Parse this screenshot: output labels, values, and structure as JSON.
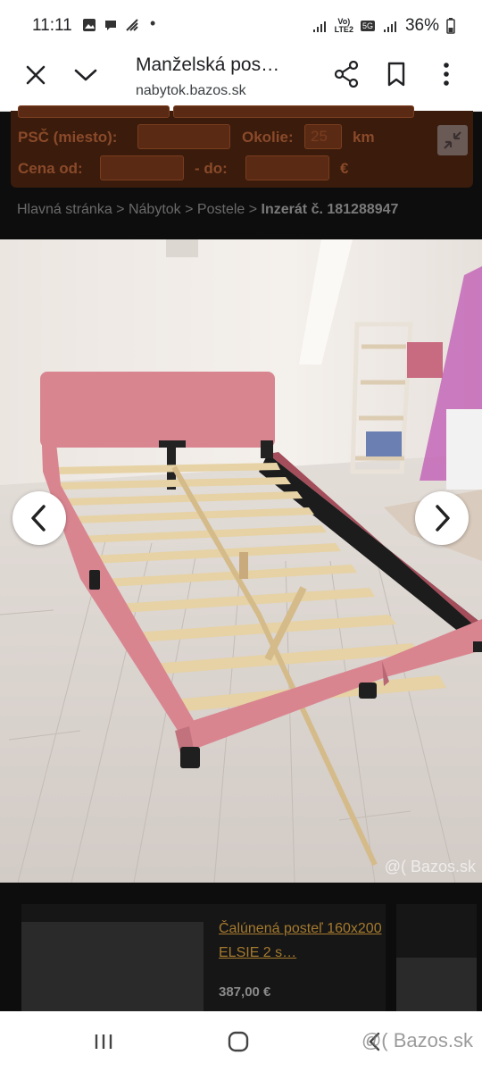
{
  "status_bar": {
    "time": "11:11",
    "network": "LTE2",
    "battery": "36%"
  },
  "browser": {
    "title": "Manželská pos…",
    "url": "nabytok.bazos.sk"
  },
  "search_form": {
    "psc_label": "PSČ  (miesto):",
    "okolie_label": "Okolie:",
    "okolie_value": "25",
    "km_label": "km",
    "cena_od_label": "Cena  od:",
    "do_label": "- do:",
    "currency": "€"
  },
  "breadcrumb": {
    "home": "Hlavná stránka",
    "category": "Nábytok",
    "subcategory": "Postele",
    "listing": "Inzerát č. 181288947",
    "separator": ">"
  },
  "gallery": {
    "watermark": "@( Bazos.sk"
  },
  "related": {
    "title": "Čalúnená posteľ 160x200 ELSIE 2 s…",
    "price": "387,00 €"
  },
  "nav_bar": {
    "watermark": "@( Bazos.sk"
  },
  "colors": {
    "panel": "#3a1b0c",
    "link": "#a57a2e",
    "bed_frame": "#d98590"
  }
}
